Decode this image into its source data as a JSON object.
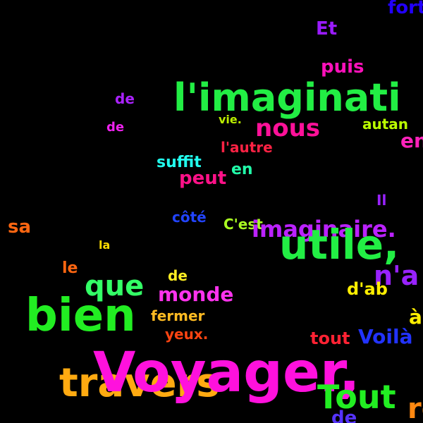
{
  "words": {
    "fort": {
      "text": "fort",
      "color": "#2200ff"
    },
    "et": {
      "text": "Et",
      "color": "#9a1bff"
    },
    "puis": {
      "text": "puis",
      "color": "#ff11bb"
    },
    "imagination": {
      "text": "l'imaginati",
      "color": "#22ee44"
    },
    "de1": {
      "text": "de",
      "color": "#aa22ff"
    },
    "vie": {
      "text": "vie.",
      "color": "#bbee00"
    },
    "nous": {
      "text": "nous",
      "color": "#ff1199"
    },
    "autant": {
      "text": "autan",
      "color": "#bbff00"
    },
    "de2": {
      "text": "de",
      "color": "#ee22ee"
    },
    "en1": {
      "text": "en",
      "color": "#ff22bb"
    },
    "lautre": {
      "text": "l'autre",
      "color": "#ff2244"
    },
    "suffit": {
      "text": "suffit",
      "color": "#22ffee"
    },
    "en2": {
      "text": "en",
      "color": "#22ffaa"
    },
    "peut": {
      "text": "peut",
      "color": "#ff1188"
    },
    "il": {
      "text": "Il",
      "color": "#9922ff"
    },
    "cote": {
      "text": "côté",
      "color": "#2244ff"
    },
    "cest": {
      "text": "C'est",
      "color": "#aaff22"
    },
    "sa": {
      "text": "sa",
      "color": "#ff6611"
    },
    "imaginaire": {
      "text": "imaginaire.",
      "color": "#bb22ff"
    },
    "utile": {
      "text": "utile,",
      "color": "#22ee44"
    },
    "la": {
      "text": "la",
      "color": "#ffdd00"
    },
    "le": {
      "text": "le",
      "color": "#ff6611"
    },
    "n": {
      "text": "n'a",
      "color": "#9922ff"
    },
    "de3": {
      "text": "de",
      "color": "#ffee22"
    },
    "que": {
      "text": "que",
      "color": "#33ff66"
    },
    "dab": {
      "text": "d'ab",
      "color": "#ffee00"
    },
    "monde": {
      "text": "monde",
      "color": "#ff33ee"
    },
    "bien": {
      "text": "bien",
      "color": "#22ee22"
    },
    "fermer": {
      "text": "fermer",
      "color": "#ffbb22"
    },
    "a": {
      "text": "à",
      "color": "#ffee00"
    },
    "yeux": {
      "text": "yeux.",
      "color": "#ff4411"
    },
    "tout1": {
      "text": "tout",
      "color": "#ff2233"
    },
    "voila": {
      "text": "Voilà",
      "color": "#2233ff"
    },
    "travers": {
      "text": "travers",
      "color": "#ffaa11"
    },
    "voyager": {
      "text": "Voyager,",
      "color": "#ff11dd"
    },
    "tout2": {
      "text": "Tout",
      "color": "#22ee22"
    },
    "de4": {
      "text": "de",
      "color": "#5533ff"
    },
    "re": {
      "text": "re",
      "color": "#ff8811"
    }
  }
}
